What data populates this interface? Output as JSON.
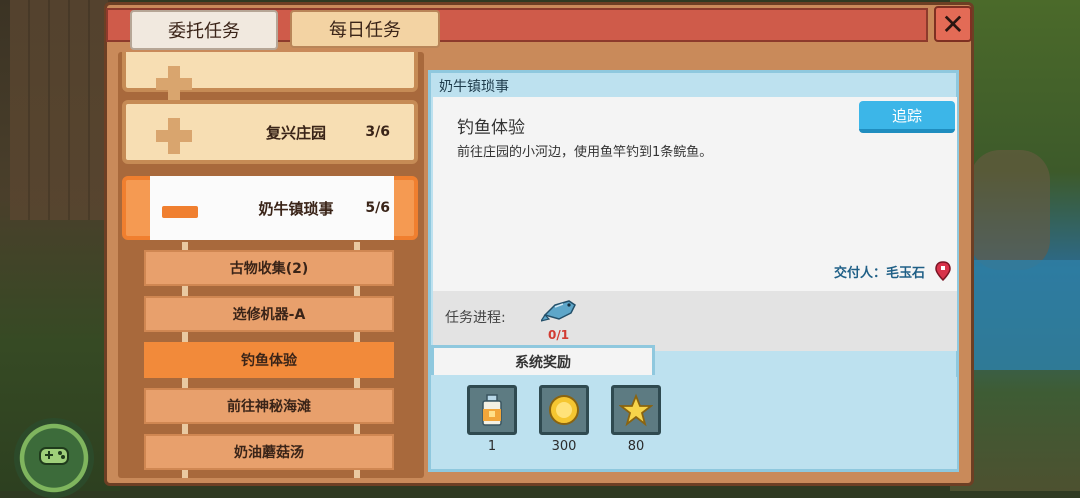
{
  "tabs": {
    "commission": "委托任务",
    "daily": "每日任务"
  },
  "close_label": "✕",
  "categories": [
    {
      "name": "",
      "count": ""
    },
    {
      "name": "复兴庄园",
      "count": "3/6"
    },
    {
      "name": "奶牛镇琐事",
      "count": "5/6"
    }
  ],
  "subtasks": [
    "古物收集(2)",
    "选修机器-A",
    "钓鱼体验",
    "前往神秘海滩",
    "奶油蘑菇汤"
  ],
  "detail": {
    "header": "奶牛镇琐事",
    "quest_title": "钓鱼体验",
    "quest_desc": "前往庄园的小河边，使用鱼竿钓到1条鲩鱼。",
    "track_label": "追踪",
    "giver": "交付人：毛玉石",
    "progress_label": "任务进程:",
    "progress_value": "0/1",
    "rewards_tab": "系统奖励",
    "rewards": [
      {
        "icon": "milk-bottle-icon",
        "qty": "1"
      },
      {
        "icon": "gold-coin-icon",
        "qty": "300"
      },
      {
        "icon": "star-icon",
        "qty": "80"
      }
    ]
  },
  "colors": {
    "accent": "#f28a3a",
    "track": "#3cb6e8",
    "header": "#cf5b4a"
  }
}
